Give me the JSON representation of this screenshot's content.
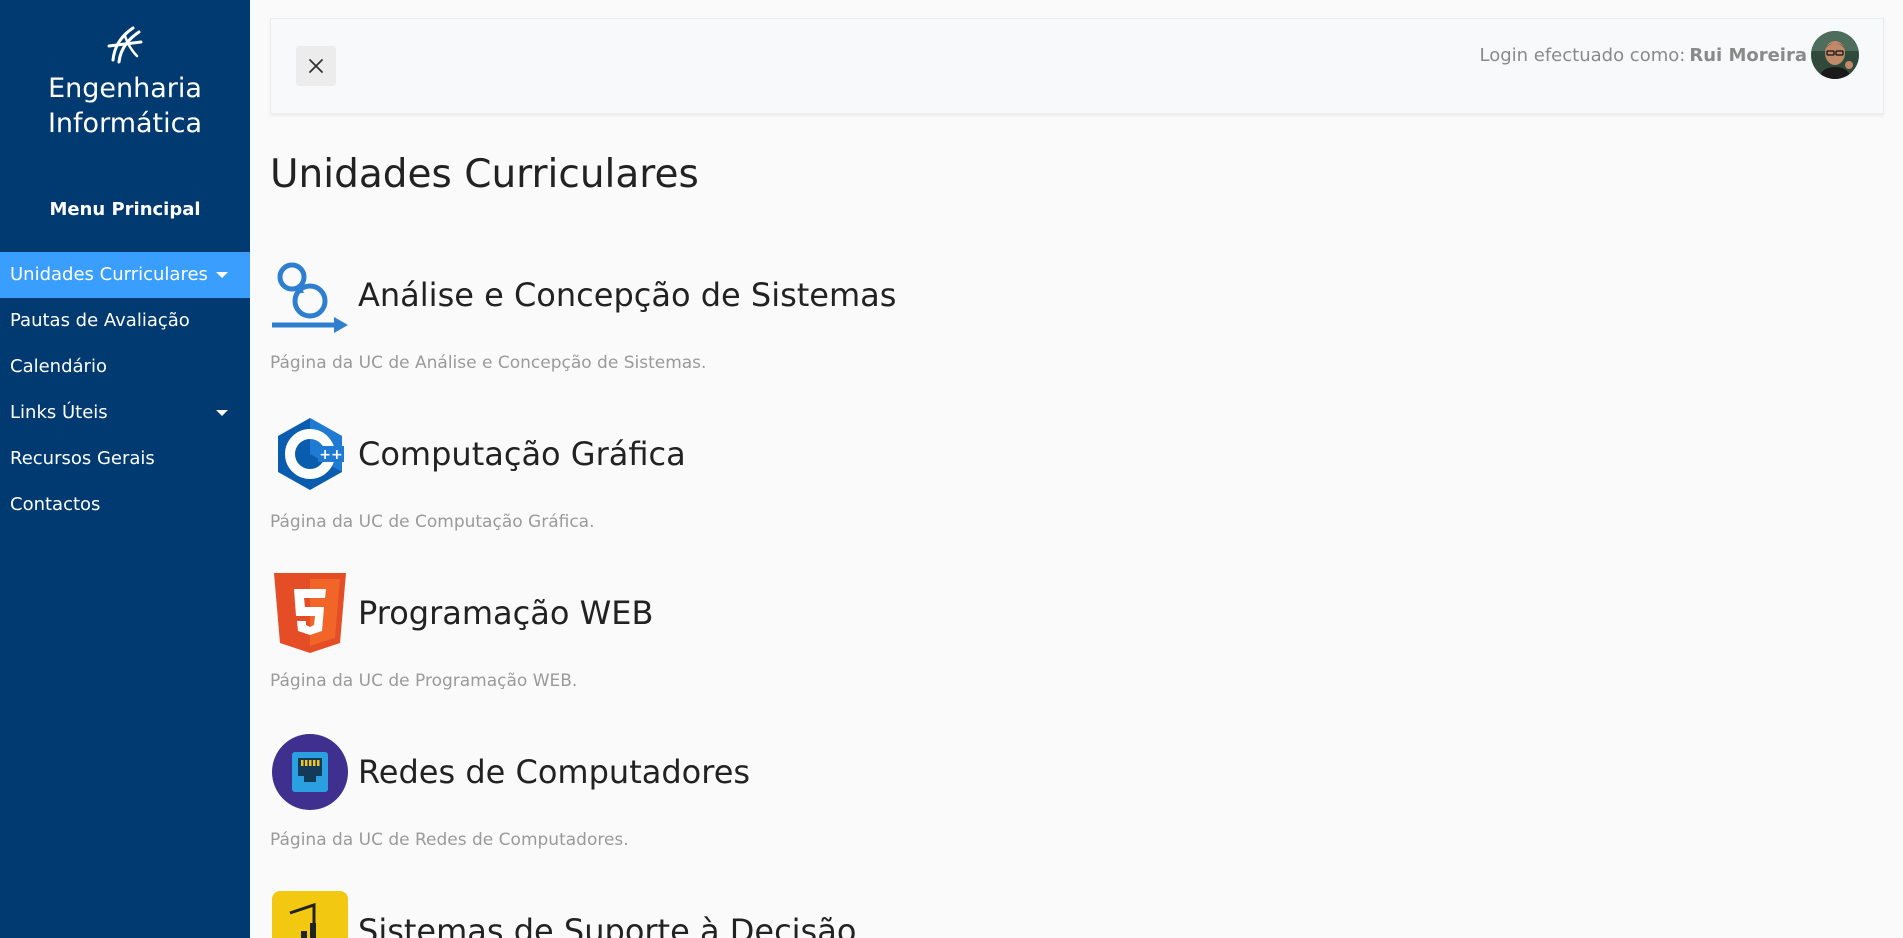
{
  "sidebar": {
    "brand_line1": "Engenharia",
    "brand_line2": "Informática",
    "menu_heading": "Menu Principal",
    "items": [
      {
        "label": "Unidades Curriculares",
        "active": true,
        "has_caret": true
      },
      {
        "label": "Pautas de Avaliação",
        "active": false,
        "has_caret": false
      },
      {
        "label": "Calendário",
        "active": false,
        "has_caret": false
      },
      {
        "label": "Links Úteis",
        "active": false,
        "has_caret": true
      },
      {
        "label": "Recursos Gerais",
        "active": false,
        "has_caret": false
      },
      {
        "label": "Contactos",
        "active": false,
        "has_caret": false
      }
    ]
  },
  "topbar": {
    "close_icon": "close-icon",
    "login_prefix": "Login efectuado como:",
    "user_name": "Rui Moreira"
  },
  "main": {
    "title": "Unidades Curriculares",
    "courses": [
      {
        "title": "Análise e Concepção de Sistemas",
        "description": "Página da UC de Análise e Concepção de Sistemas.",
        "icon": "scrum-cycle-icon"
      },
      {
        "title": "Computação Gráfica",
        "description": "Página da UC de Computação Gráfica.",
        "icon": "cpp-icon"
      },
      {
        "title": "Programação WEB",
        "description": "Página da UC de Programação WEB.",
        "icon": "html5-icon"
      },
      {
        "title": "Redes de Computadores",
        "description": "Página da UC de Redes de Computadores.",
        "icon": "ethernet-port-icon"
      },
      {
        "title": "Sistemas de Suporte à Decisão",
        "description": "",
        "icon": "power-bi-icon"
      }
    ]
  },
  "colors": {
    "sidebar_bg": "#003a70",
    "active_item_bg": "#3a9eff",
    "page_bg": "#fafafa"
  }
}
